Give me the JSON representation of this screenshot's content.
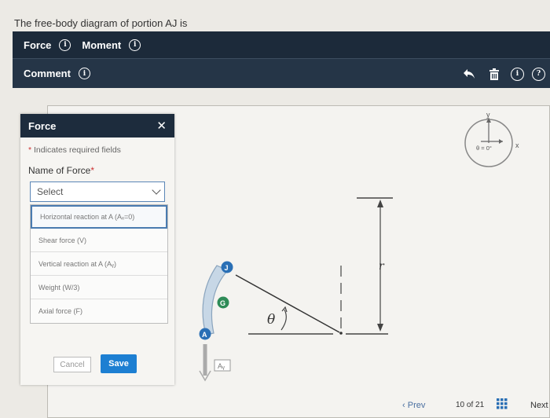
{
  "question": "The free-body diagram of portion AJ is",
  "toolbar": {
    "force_label": "Force",
    "moment_label": "Moment",
    "comment_label": "Comment"
  },
  "panel": {
    "title": "Force",
    "required_note": "Indicates required fields",
    "name_label": "Name of Force",
    "select_value": "Select",
    "options": [
      "Horizontal reaction at A (Aₓ=0)",
      "Shear force (V)",
      "Vertical reaction at A (Aᵧ)",
      "Weight (W/3)",
      "Axial force (F)"
    ],
    "cancel_label": "Cancel",
    "save_label": "Save"
  },
  "diagram": {
    "axis_y": "y",
    "axis_x": "x",
    "angle_readout": "θ = 0°",
    "point_j": "J",
    "point_g": "G",
    "point_a": "A",
    "box_label": "Aᵧ",
    "theta": "θ",
    "radius": "r"
  },
  "footer": {
    "prev_label": "Prev",
    "page_count": "10 of 21",
    "next_label": "Next"
  },
  "colors": {
    "toolbar_top": "#1c2a3a",
    "toolbar_bottom": "#253547",
    "accent_blue": "#1d7fd2",
    "point_blue": "#2a6fb5",
    "point_green": "#2e8b57"
  }
}
